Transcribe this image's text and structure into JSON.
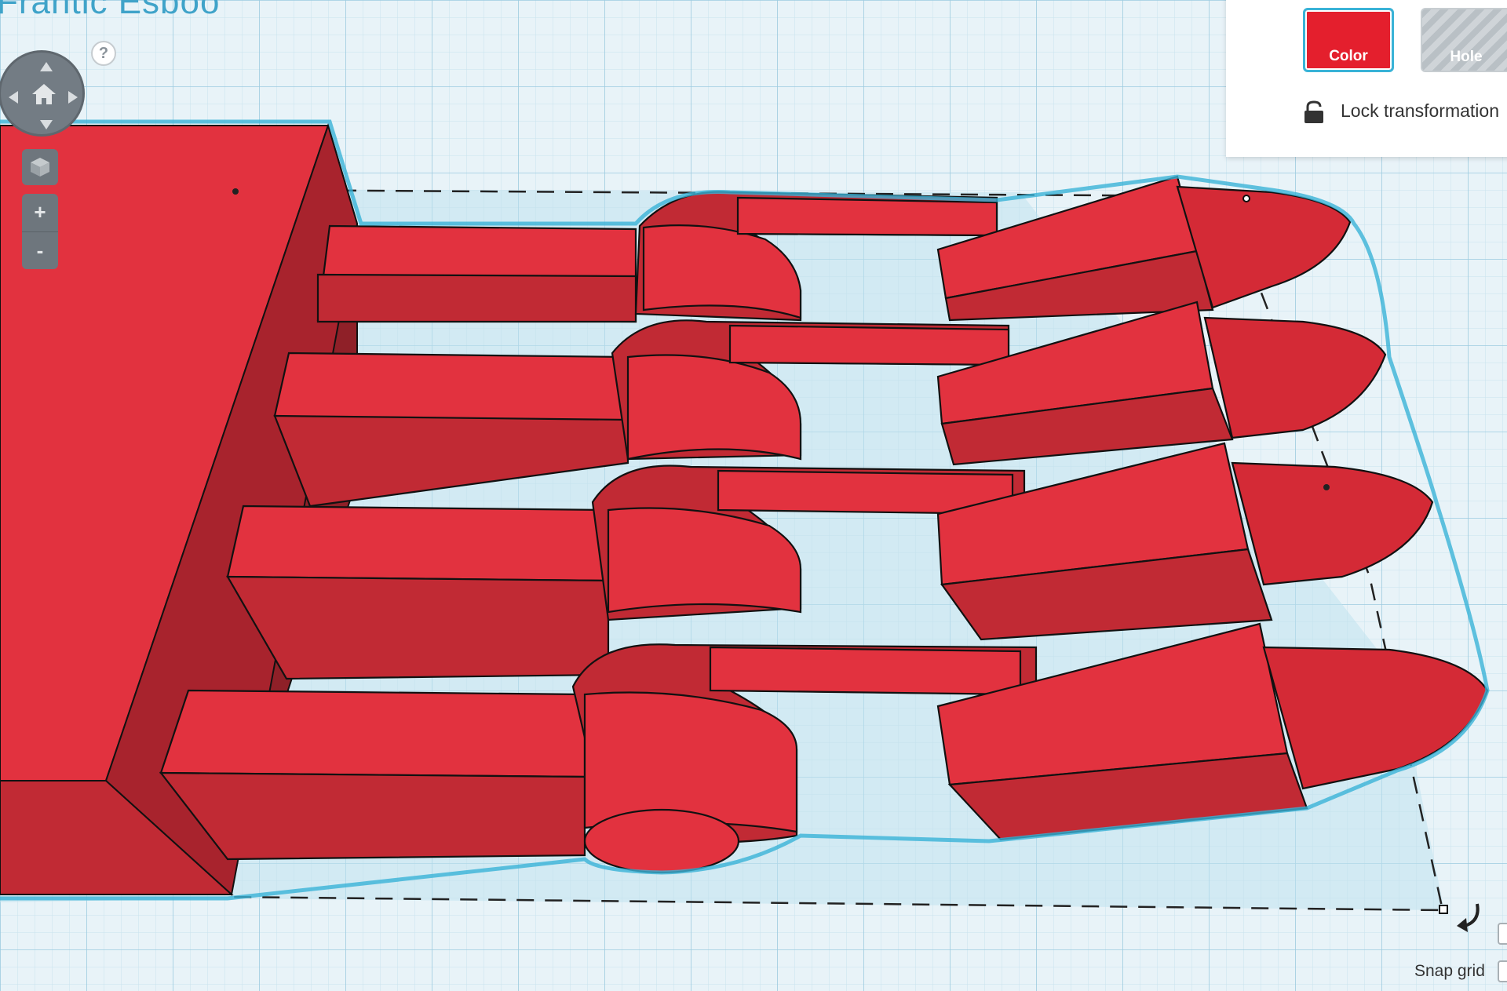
{
  "design": {
    "title": "Frantic Esboo"
  },
  "help": {
    "label": "?"
  },
  "view_controls": {
    "zoom_in_label": "+",
    "zoom_out_label": "-"
  },
  "inspector": {
    "color_label": "Color",
    "hole_label": "Hole",
    "lock_label": "Lock transformation"
  },
  "footer": {
    "snap_grid_label": "Snap grid"
  },
  "colors": {
    "shape_red": "#e2323f",
    "selection_outline": "#39b3d7",
    "grid_line": "#b5d8e8",
    "workplane": "#e8f3f8"
  },
  "icons": [
    "home-icon",
    "view-cube-icon",
    "lock-icon",
    "rotate-icon",
    "help-icon"
  ]
}
